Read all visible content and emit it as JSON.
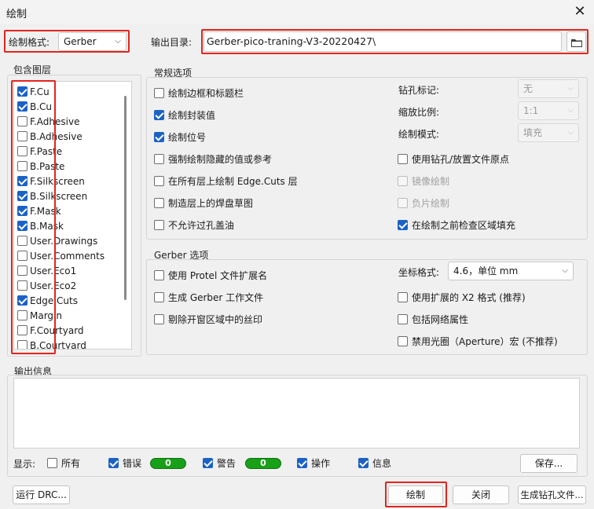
{
  "window": {
    "title": "绘制",
    "close_glyph": "✕"
  },
  "format": {
    "label": "绘制格式:",
    "value": "Gerber"
  },
  "output_dir": {
    "label": "输出目录:",
    "value": "Gerber-pico-traning-V3-20220427\\"
  },
  "layers": {
    "group_label": "包含图层",
    "items": [
      {
        "label": "F.Cu",
        "checked": true
      },
      {
        "label": "B.Cu",
        "checked": true
      },
      {
        "label": "F.Adhesive",
        "checked": false
      },
      {
        "label": "B.Adhesive",
        "checked": false
      },
      {
        "label": "F.Paste",
        "checked": false
      },
      {
        "label": "B.Paste",
        "checked": false
      },
      {
        "label": "F.Silkscreen",
        "checked": true
      },
      {
        "label": "B.Silkscreen",
        "checked": true
      },
      {
        "label": "F.Mask",
        "checked": true
      },
      {
        "label": "B.Mask",
        "checked": true
      },
      {
        "label": "User.Drawings",
        "checked": false
      },
      {
        "label": "User.Comments",
        "checked": false
      },
      {
        "label": "User.Eco1",
        "checked": false
      },
      {
        "label": "User.Eco2",
        "checked": false
      },
      {
        "label": "Edge.Cuts",
        "checked": true
      },
      {
        "label": "Margin",
        "checked": false
      },
      {
        "label": "F.Courtyard",
        "checked": false
      },
      {
        "label": "B.Courtyard",
        "checked": false
      }
    ]
  },
  "general": {
    "group_label": "常规选项",
    "left_options": [
      {
        "label": "绘制边框和标题栏",
        "checked": false
      },
      {
        "label": "绘制封装值",
        "checked": true
      },
      {
        "label": "绘制位号",
        "checked": true
      },
      {
        "label": "强制绘制隐藏的值或参考",
        "checked": false
      },
      {
        "label": "在所有层上绘制 Edge.Cuts 层",
        "checked": false
      },
      {
        "label": "制造层上的焊盘草图",
        "checked": false
      },
      {
        "label": "不允许过孔盖油",
        "checked": false
      }
    ],
    "drill_marks": {
      "label": "钻孔标记:",
      "value": "无"
    },
    "scale": {
      "label": "缩放比例:",
      "value": "1:1"
    },
    "plot_mode": {
      "label": "绘制模式:",
      "value": "填充"
    },
    "right_options": [
      {
        "label": "使用钻孔/放置文件原点",
        "checked": false,
        "disabled": false
      },
      {
        "label": "镜像绘制",
        "checked": false,
        "disabled": true
      },
      {
        "label": "负片绘制",
        "checked": false,
        "disabled": true
      },
      {
        "label": "在绘制之前检查区域填充",
        "checked": true,
        "disabled": false
      }
    ]
  },
  "gerber": {
    "group_label": "Gerber 选项",
    "left_options": [
      {
        "label": "使用 Protel 文件扩展名",
        "checked": false
      },
      {
        "label": "生成 Gerber 工作文件",
        "checked": false
      },
      {
        "label": "剔除开窗区域中的丝印",
        "checked": false
      }
    ],
    "coord_format": {
      "label": "坐标格式:",
      "value": "4.6，单位 mm"
    },
    "right_options": [
      {
        "label": "使用扩展的 X2 格式 (推荐)",
        "checked": false
      },
      {
        "label": "包括网络属性",
        "checked": false
      },
      {
        "label": "禁用光圈（Aperture）宏 (不推荐)",
        "checked": false
      }
    ]
  },
  "messages": {
    "group_label": "输出信息",
    "show_label": "显示:",
    "filters": {
      "all": {
        "label": "所有",
        "checked": false
      },
      "errors": {
        "label": "错误",
        "checked": true,
        "count": "0"
      },
      "warnings": {
        "label": "警告",
        "checked": true,
        "count": "0"
      },
      "actions": {
        "label": "操作",
        "checked": true
      },
      "infos": {
        "label": "信息",
        "checked": true
      }
    },
    "save_label": "保存..."
  },
  "footer": {
    "run_drc": "运行 DRC...",
    "plot": "绘制",
    "close": "关闭",
    "gen_drill": "生成钻孔文件..."
  }
}
